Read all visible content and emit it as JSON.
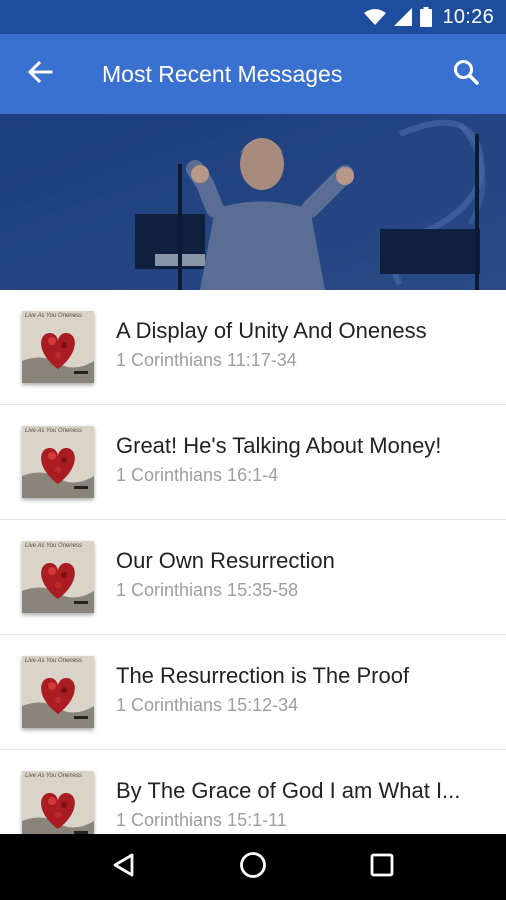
{
  "status_bar": {
    "time": "10:26",
    "icons": [
      "wifi-icon",
      "signal-icon",
      "battery-icon"
    ]
  },
  "app_bar": {
    "title": "Most Recent Messages",
    "back_icon": "arrow-back-icon",
    "search_icon": "search-icon"
  },
  "hero": {
    "image": "preacher-on-stage"
  },
  "messages": [
    {
      "title": "A Display of Unity And Oneness",
      "reference": "1 Corinthians 11:17-34",
      "thumb_text": "Live As You Oneness"
    },
    {
      "title": "Great! He's Talking About Money!",
      "reference": "1 Corinthians 16:1-4",
      "thumb_text": "Live As You Oneness"
    },
    {
      "title": "Our Own Resurrection",
      "reference": "1 Corinthians 15:35-58",
      "thumb_text": "Live As You Oneness"
    },
    {
      "title": "The Resurrection is The Proof",
      "reference": "1 Corinthians 15:12-34",
      "thumb_text": "Live As You Oneness"
    },
    {
      "title": "By The Grace of God I am What I...",
      "reference": "1 Corinthians 15:1-11",
      "thumb_text": "Live As You Oneness"
    }
  ],
  "nav_bar": {
    "icons": [
      "nav-back-icon",
      "nav-home-icon",
      "nav-recents-icon"
    ]
  },
  "colors": {
    "status_bar": "#1f4d9e",
    "app_bar": "#3a71d1",
    "hero_overlay": "#22407a"
  }
}
